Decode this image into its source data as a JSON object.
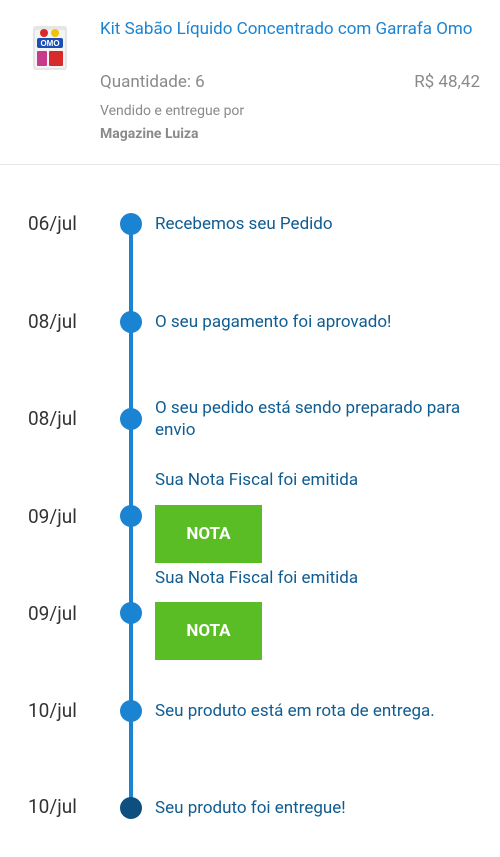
{
  "product": {
    "title": "Kit Sabão Líquido Concentrado com Garrafa Omo",
    "quantity": "Quantidade: 6",
    "price": "R$ 48,42",
    "seller_label": "Vendido e entregue por",
    "seller_name": "Magazine Luiza",
    "image_brand": "OMO"
  },
  "timeline": [
    {
      "date": "06/jul",
      "text": "Recebemos seu Pedido"
    },
    {
      "date": "08/jul",
      "text": "O seu pagamento foi aprovado!"
    },
    {
      "date": "08/jul",
      "text": "O seu pedido está sendo preparado para envio"
    },
    {
      "date": "09/jul",
      "text": "Sua Nota Fiscal foi emitida",
      "button": "NOTA"
    },
    {
      "date": "09/jul",
      "text": "Sua Nota Fiscal foi emitida",
      "button": "NOTA"
    },
    {
      "date": "10/jul",
      "text": "Seu produto está em rota de entrega."
    },
    {
      "date": "10/jul",
      "text": "Seu produto foi entregue!"
    }
  ],
  "colors": {
    "accent_blue": "#1a83d2",
    "text_blue": "#0f5c92",
    "final_dot": "#0d4f7f",
    "button_green": "#5bbd26",
    "muted_gray": "#8a8a8a"
  }
}
